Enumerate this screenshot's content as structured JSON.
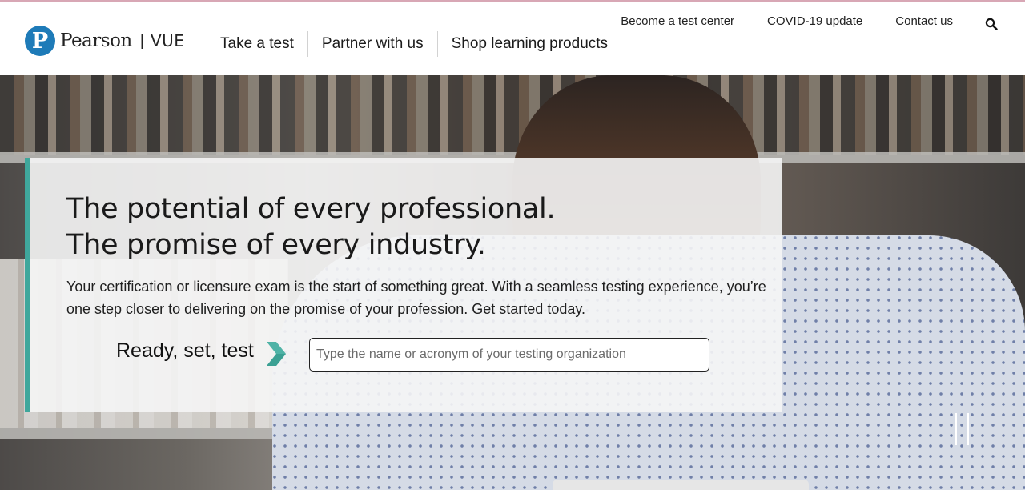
{
  "brand": {
    "logo_letter": "P",
    "name": "Pearson",
    "separator": "|",
    "product": "VUE",
    "accent_color": "#1e7bb8"
  },
  "utility_nav": {
    "items": [
      "Become a test center",
      "COVID-19 update",
      "Contact us"
    ],
    "search_icon": "search-icon"
  },
  "main_nav": {
    "items": [
      "Take a test",
      "Partner with us",
      "Shop learning products"
    ]
  },
  "hero": {
    "headline_line1": "The potential of every professional.",
    "headline_line2": "The promise of every industry.",
    "lede": "Your certification or licensure exam is the start of something great. With a seamless testing experience, you’re one step closer to delivering on the promise of your profession. Get started today.",
    "cta_label": "Ready, set, test",
    "cta_icon": "chevron-right-icon",
    "search_placeholder": "Type the name or acronym of your testing organization",
    "search_value": "",
    "card_accent_color": "#3fa79c",
    "media_control_icon": "pause-icon"
  }
}
